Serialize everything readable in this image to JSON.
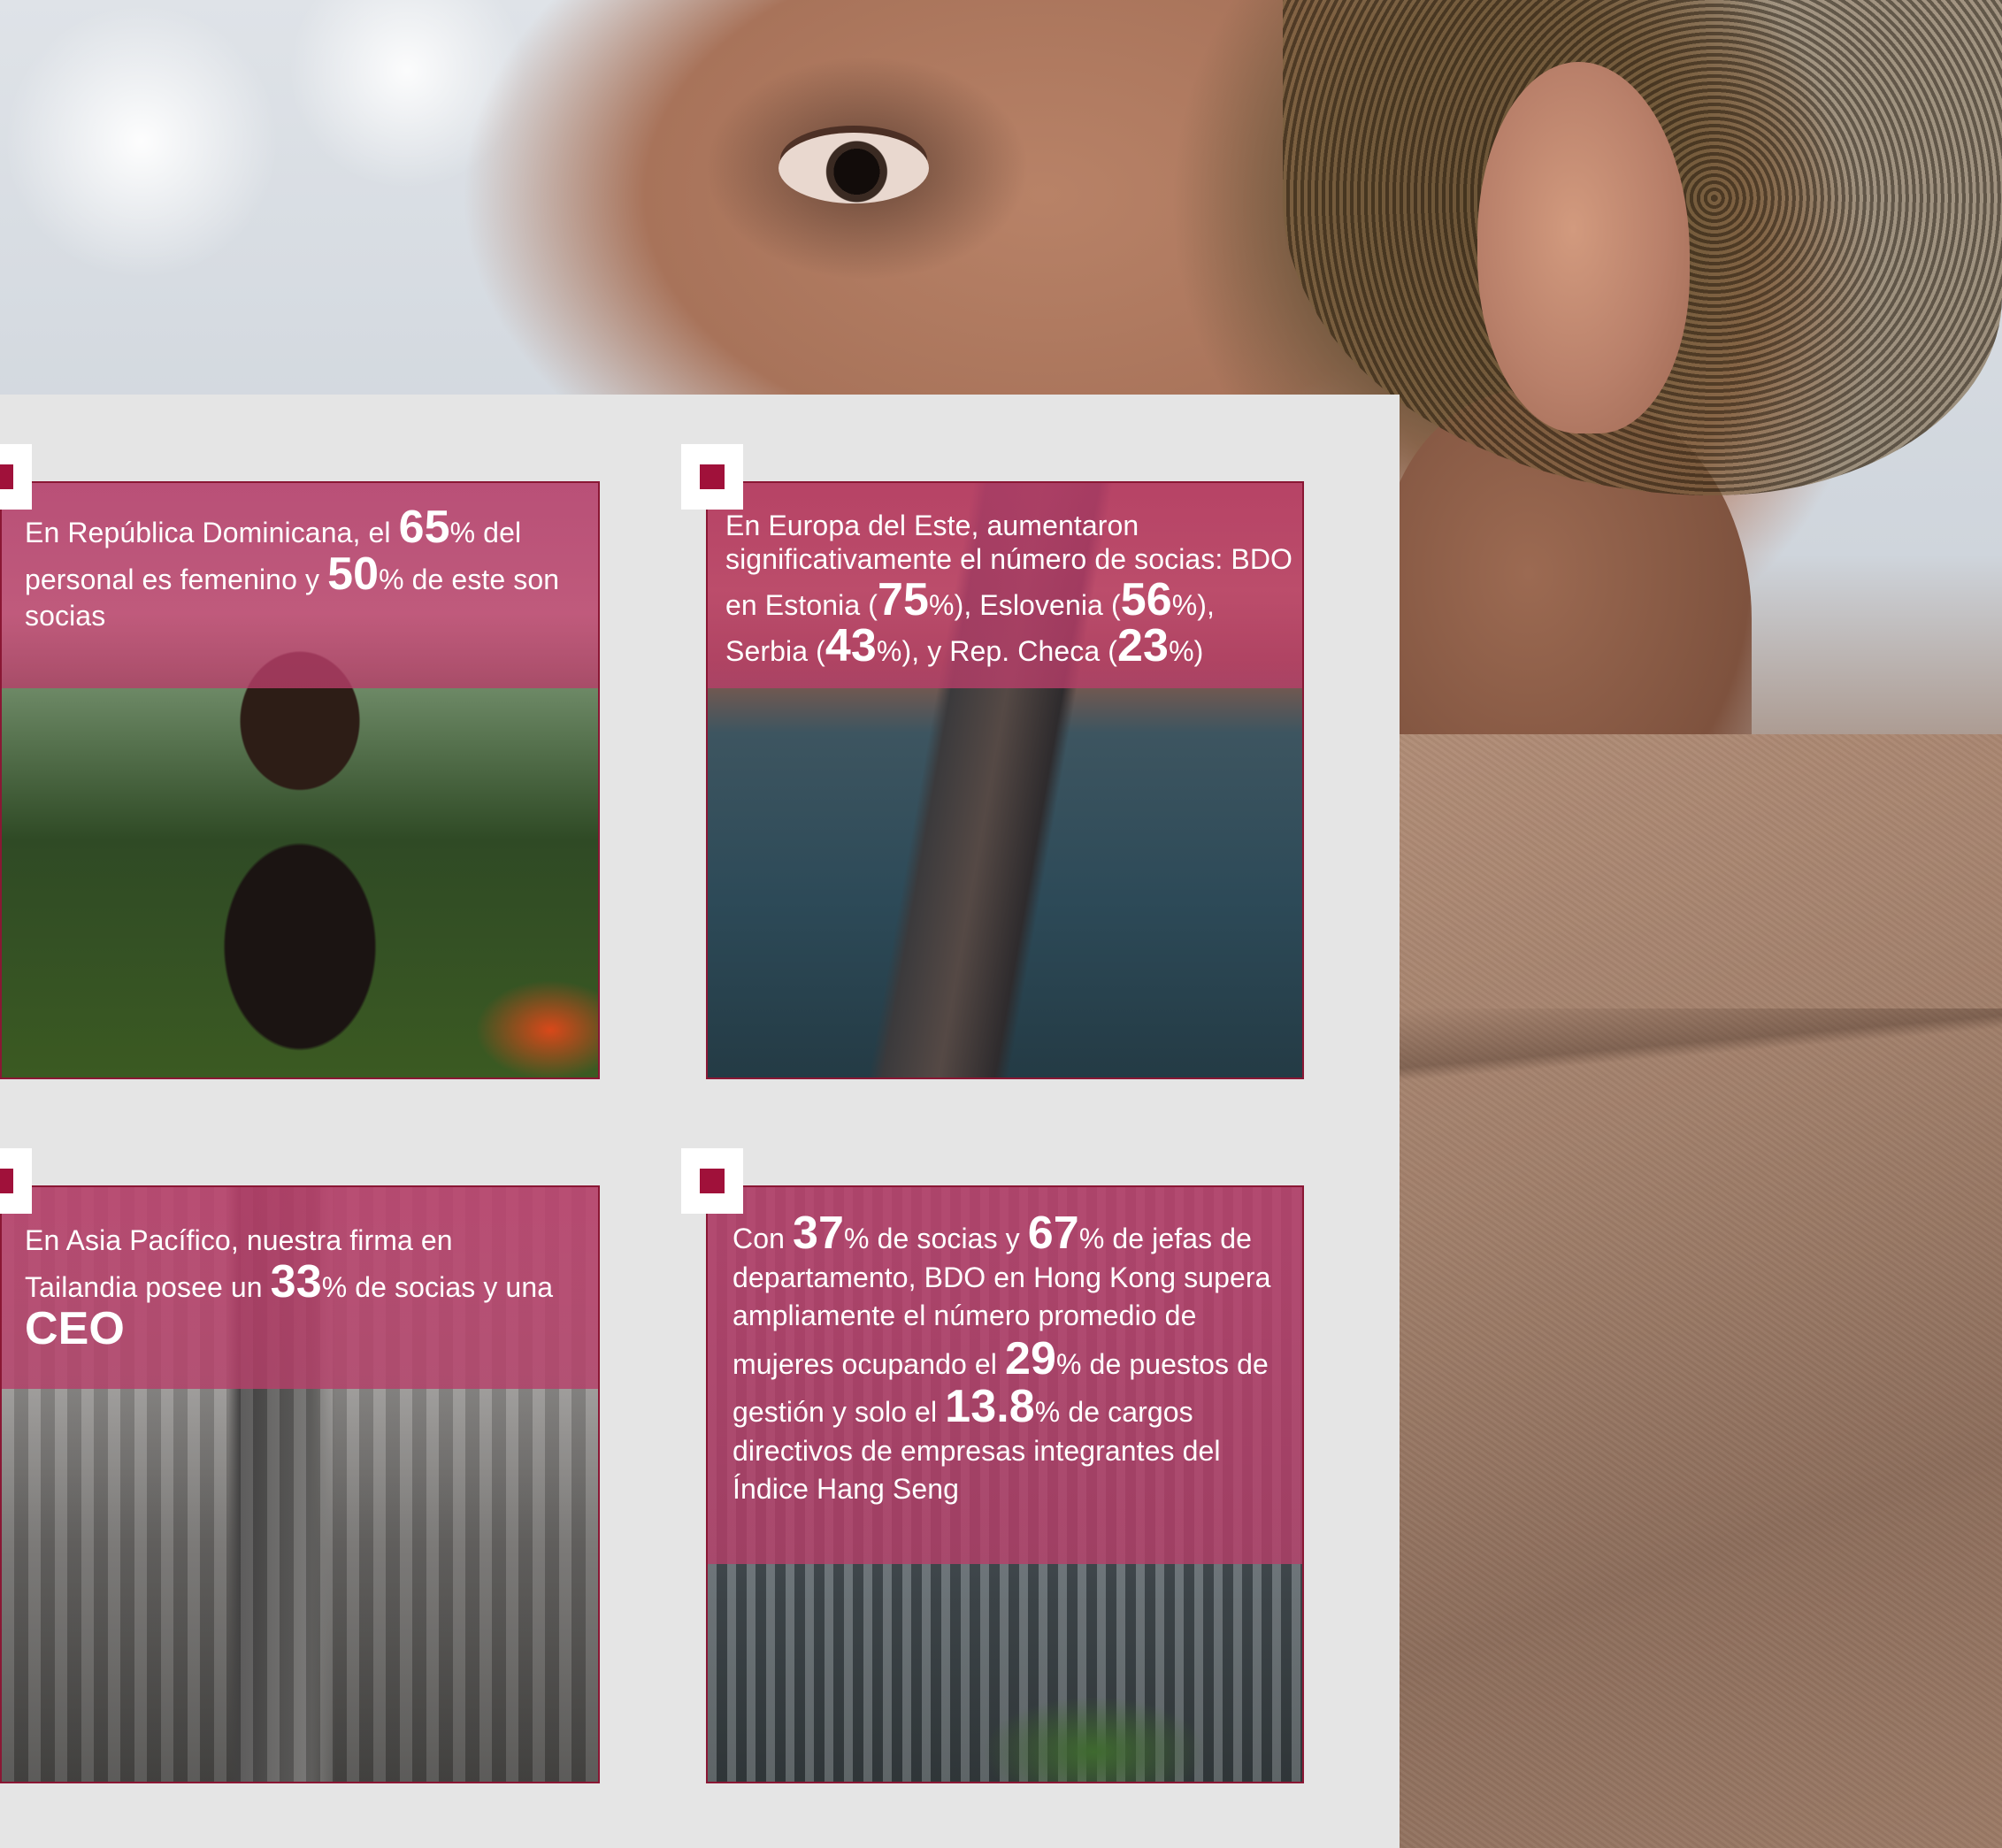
{
  "colors": {
    "accent": "#a0113a",
    "card_border": "#8a1734",
    "overlay": "#b73e69",
    "panel_bg": "#e5e5e5",
    "text": "#ffffff"
  },
  "cards": [
    {
      "icon": "square-marker-icon",
      "photo": "woman-in-tropical-garden",
      "parts": [
        "En República Dominicana, el ",
        "65",
        "% del personal es femenino y ",
        "50",
        "%  de este son socias"
      ]
    },
    {
      "icon": "square-marker-icon",
      "photo": "prague-charles-bridge-aerial",
      "parts": [
        "En Europa del Este, aumentaron significativamente el número de socias: BDO en Estonia (",
        "75",
        "%), Eslovenia (",
        "56",
        "%), Serbia (",
        "43",
        "%), y Rep. Checa (",
        "23",
        "%)"
      ]
    },
    {
      "icon": "square-marker-icon",
      "photo": "bangkok-skyline-aerial",
      "parts": [
        "En Asia Pacífico, nuestra firma en Tailandia posee un ",
        "33",
        "% de socias y una ",
        "CEO",
        ""
      ]
    },
    {
      "icon": "square-marker-icon",
      "photo": "hong-kong-skyline",
      "parts": [
        "Con ",
        "37",
        "% de socias y ",
        "67",
        "% de jefas de departamento, BDO en Hong Kong supera ampliamente el número promedio de mujeres ocupando el ",
        "29",
        "% de puestos de gestión y solo el ",
        "13.8",
        "% de cargos directivos de empresas integrantes del Índice Hang Seng"
      ]
    }
  ]
}
